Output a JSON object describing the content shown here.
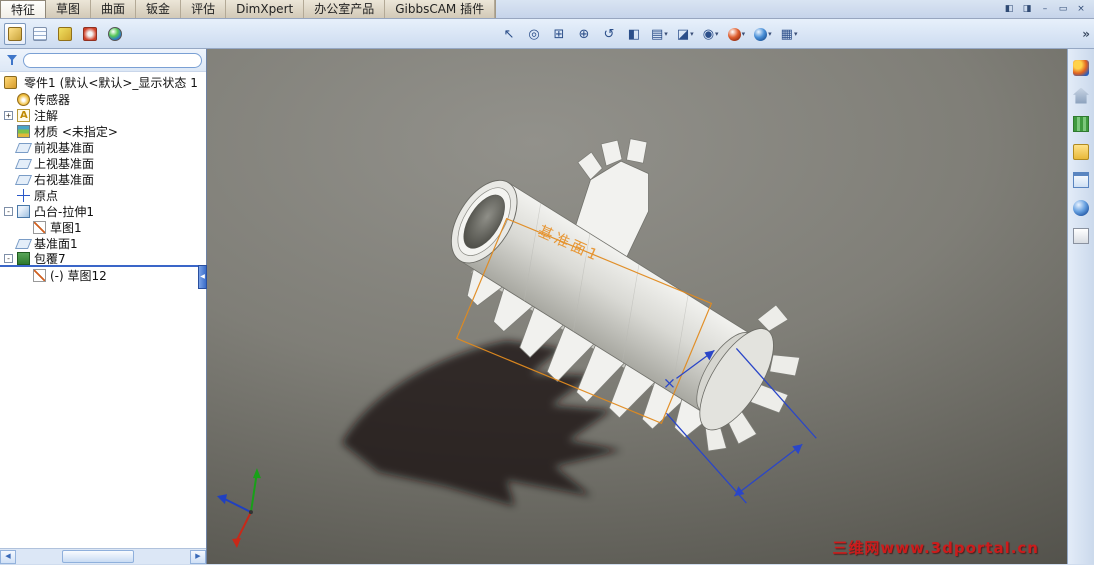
{
  "tabs": {
    "items": [
      {
        "name": "tab-features",
        "label": "特征",
        "active": true
      },
      {
        "name": "tab-sketch",
        "label": "草图"
      },
      {
        "name": "tab-surfaces",
        "label": "曲面"
      },
      {
        "name": "tab-sheet-metal",
        "label": "钣金"
      },
      {
        "name": "tab-evaluate",
        "label": "评估"
      },
      {
        "name": "tab-dimxpert",
        "label": "DimXpert"
      },
      {
        "name": "tab-office-products",
        "label": "办公室产品"
      },
      {
        "name": "tab-gibbscam",
        "label": "GibbsCAM 插件"
      }
    ]
  },
  "window_buttons": [
    {
      "name": "dock-pane-left-button",
      "glyph": "◧"
    },
    {
      "name": "dock-pane-right-button",
      "glyph": "◨"
    },
    {
      "name": "minimize-button",
      "glyph": "–"
    },
    {
      "name": "restore-button",
      "glyph": "▭"
    },
    {
      "name": "close-button",
      "glyph": "×"
    }
  ],
  "manager_tabs": {
    "overflow_glyph": "»",
    "items": [
      {
        "name": "featuremanager-tab",
        "cls": "mgr-feature",
        "active": true
      },
      {
        "name": "propertymanager-tab",
        "cls": "mgr-property"
      },
      {
        "name": "configurationmanager-tab",
        "cls": "mgr-config"
      },
      {
        "name": "dimxpertmanager-tab",
        "cls": "mgr-dimx"
      },
      {
        "name": "displaymanager-tab",
        "cls": "mgr-display"
      }
    ]
  },
  "view_toolbar": {
    "items": [
      {
        "name": "select-tool-button",
        "glyph": "↖"
      },
      {
        "name": "zoom-fit-button",
        "glyph": "◎"
      },
      {
        "name": "zoom-area-button",
        "glyph": "⊞"
      },
      {
        "name": "zoom-in-out-button",
        "glyph": "⊕"
      },
      {
        "name": "rotate-view-button",
        "glyph": "↺"
      },
      {
        "name": "section-view-button",
        "glyph": "◧"
      },
      {
        "name": "view-orientation-button",
        "glyph": "▤",
        "dropdown": true
      },
      {
        "name": "display-style-button",
        "glyph": "◪",
        "dropdown": true
      },
      {
        "name": "hide-show-items-button",
        "glyph": "◉",
        "dropdown": true
      },
      {
        "name": "edit-appearance-button",
        "glyph": "",
        "cls": "ball-appearance",
        "dropdown": true
      },
      {
        "name": "apply-scene-button",
        "glyph": "",
        "cls": "ball-scene",
        "dropdown": true
      },
      {
        "name": "view-settings-button",
        "glyph": "▦",
        "dropdown": true
      }
    ]
  },
  "feature_tree": {
    "root": {
      "label": "零件1",
      "suffix": "(默认<默认>_显示状态 1"
    },
    "items": [
      {
        "name": "tree-item-sensors",
        "indent": 0,
        "expander": "",
        "icon": "sensors",
        "label": "传感器"
      },
      {
        "name": "tree-item-annotations",
        "indent": 0,
        "expander": "+",
        "icon": "annotations",
        "label": "注解"
      },
      {
        "name": "tree-item-material",
        "indent": 0,
        "expander": "",
        "icon": "material",
        "label": "材质 <未指定>"
      },
      {
        "name": "tree-item-front-plane",
        "indent": 0,
        "expander": "",
        "icon": "plane",
        "label": "前视基准面"
      },
      {
        "name": "tree-item-top-plane",
        "indent": 0,
        "expander": "",
        "icon": "plane",
        "label": "上视基准面"
      },
      {
        "name": "tree-item-right-plane",
        "indent": 0,
        "expander": "",
        "icon": "plane",
        "label": "右视基准面"
      },
      {
        "name": "tree-item-origin",
        "indent": 0,
        "expander": "",
        "icon": "origin",
        "label": "原点"
      },
      {
        "name": "tree-item-boss-extrude1",
        "indent": 0,
        "expander": "-",
        "icon": "extrude",
        "label": "凸台-拉伸1"
      },
      {
        "name": "tree-item-sketch1",
        "indent": 1,
        "expander": "",
        "icon": "sketch",
        "label": "草图1"
      },
      {
        "name": "tree-item-plane1",
        "indent": 0,
        "expander": "",
        "icon": "plane",
        "label": "基准面1"
      },
      {
        "name": "tree-item-wrap7",
        "indent": 0,
        "expander": "-",
        "icon": "wrap",
        "label": "包覆7",
        "rollback_after": true
      },
      {
        "name": "tree-item-sketch12",
        "indent": 1,
        "expander": "",
        "icon": "sketch",
        "label": "(-) 草图12"
      }
    ]
  },
  "filter": {
    "value": ""
  },
  "panel": {
    "collapse_glyph": "◀"
  },
  "scrollbar": {
    "left_glyph": "◀",
    "right_glyph": "▶"
  },
  "taskpane": {
    "items": [
      {
        "name": "taskpane-solidworks-resources",
        "cls": "tp-resources"
      },
      {
        "name": "taskpane-design-library",
        "cls": "tp-home"
      },
      {
        "name": "taskpane-toolbox",
        "cls": "tp-library"
      },
      {
        "name": "taskpane-file-explorer",
        "cls": "tp-explorer"
      },
      {
        "name": "taskpane-view-palette",
        "cls": "tp-palette"
      },
      {
        "name": "taskpane-appearances",
        "cls": "tp-appearance"
      },
      {
        "name": "taskpane-custom-properties",
        "cls": "tp-props"
      }
    ]
  },
  "viewport": {
    "plane_label": "基准面1",
    "watermark": "三维网www.3dportal.cn"
  },
  "colors": {
    "accent_orange": "#e8922a",
    "dimension_blue": "#2a46c8",
    "watermark_red": "#cc1c1c"
  }
}
